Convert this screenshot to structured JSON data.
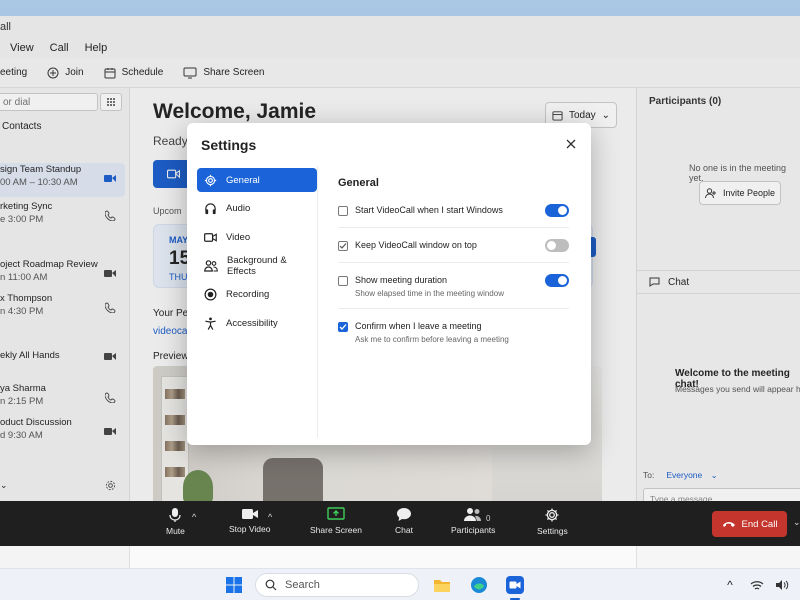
{
  "window": {
    "title": "all"
  },
  "menu": [
    "View",
    "Call",
    "Help"
  ],
  "toolbar": {
    "meeting": "eeting",
    "join": "Join",
    "schedule": "Schedule",
    "share_screen": "Share Screen"
  },
  "sidebar": {
    "search_placeholder": "or dial",
    "contacts": "Contacts",
    "items": [
      {
        "title": "sign Team Standup",
        "sub": "00 AM – 10:30 AM",
        "icon": "video-icon"
      },
      {
        "title": "rketing Sync",
        "sub": "e 3:00 PM",
        "icon": "phone-icon"
      },
      {
        "title": "oject Roadmap Review",
        "sub": "n 11:00 AM",
        "icon": "video-icon"
      },
      {
        "title": "x Thompson",
        "sub": "n 4:30 PM",
        "icon": "phone-icon"
      },
      {
        "title": "ekly All Hands",
        "sub": "",
        "icon": "video-icon"
      },
      {
        "title": "ya Sharma",
        "sub": "n 2:15 PM",
        "icon": "phone-icon"
      },
      {
        "title": "oduct Discussion",
        "sub": "d 9:30 AM",
        "icon": "video-icon"
      }
    ]
  },
  "main": {
    "welcome": "Welcome, Jamie",
    "ready": "Ready",
    "today": "Today",
    "upcoming": "Upcom",
    "date_month": "MAY",
    "date_day": "15",
    "date_weekday": "THU",
    "pmi_label": "Your Pers",
    "pmi_link": "videocall",
    "preview_label": "Preview"
  },
  "participants": {
    "title": "Participants (0)",
    "empty": "No one is in the meeting yet.",
    "invite": "Invite People"
  },
  "chat": {
    "title": "Chat",
    "welcome": "Welcome to the meeting chat!",
    "sub": "Messages you send will appear here",
    "to_label": "To:",
    "to_value": "Everyone",
    "placeholder": "Type a message..."
  },
  "settings": {
    "title": "Settings",
    "nav": [
      {
        "label": "General",
        "icon": "gear-icon",
        "active": true
      },
      {
        "label": "Audio",
        "icon": "headphones-icon",
        "active": false
      },
      {
        "label": "Video",
        "icon": "video-icon",
        "active": false
      },
      {
        "label": "Background & Effects",
        "icon": "people-icon",
        "active": false
      },
      {
        "label": "Recording",
        "icon": "record-icon",
        "active": false
      },
      {
        "label": "Accessibility",
        "icon": "accessibility-icon",
        "active": false
      }
    ],
    "section": "General",
    "options": [
      {
        "label": "Start VideoCall when I start Windows",
        "desc": "",
        "checked": false,
        "toggle": true
      },
      {
        "label": "Keep VideoCall window on top",
        "desc": "",
        "checked": true,
        "toggle": false
      },
      {
        "label": "Show meeting duration",
        "desc": "Show elapsed time in the meeting window",
        "checked": false,
        "toggle": true
      },
      {
        "label": "Confirm when I leave a meeting",
        "desc": "Ask me to confirm before leaving a meeting",
        "checked": true,
        "toggle": null
      }
    ]
  },
  "callbar": {
    "mute": "Mute",
    "stop_video": "Stop Video",
    "share_screen": "Share Screen",
    "chat": "Chat",
    "participants": "Participants",
    "participants_count": "0",
    "settings": "Settings",
    "end_call": "End Call"
  },
  "taskbar": {
    "search": "Search"
  },
  "colors": {
    "accent": "#1a63d8",
    "end_call": "#c4352d",
    "share_green": "#3ecf5a"
  }
}
